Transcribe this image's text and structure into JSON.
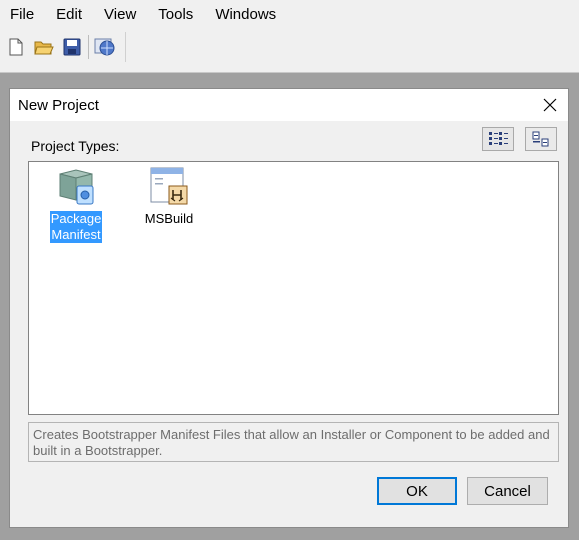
{
  "menubar": {
    "items": [
      "File",
      "Edit",
      "View",
      "Tools",
      "Windows"
    ]
  },
  "toolbar": {
    "buttons": [
      "new-file-icon",
      "open-folder-icon",
      "save-icon",
      "web-globe-icon"
    ]
  },
  "dialog": {
    "title": "New Project",
    "project_types_label": "Project Types:",
    "view_buttons": [
      "large-icons-view-icon",
      "small-icons-view-icon"
    ],
    "items": [
      {
        "label_line1": "Package",
        "label_line2": "Manifest",
        "selected": true,
        "icon": "package-manifest-icon"
      },
      {
        "label_line1": "MSBuild",
        "label_line2": "",
        "selected": false,
        "icon": "msbuild-icon"
      }
    ],
    "description": "Creates Bootstrapper Manifest Files that allow an Installer or Component to be added and built in a Bootstrapper.",
    "ok_label": "OK",
    "cancel_label": "Cancel"
  },
  "colors": {
    "selection": "#3399ff",
    "default_button_border": "#0078d7",
    "overlay": "#a0a0a0"
  }
}
